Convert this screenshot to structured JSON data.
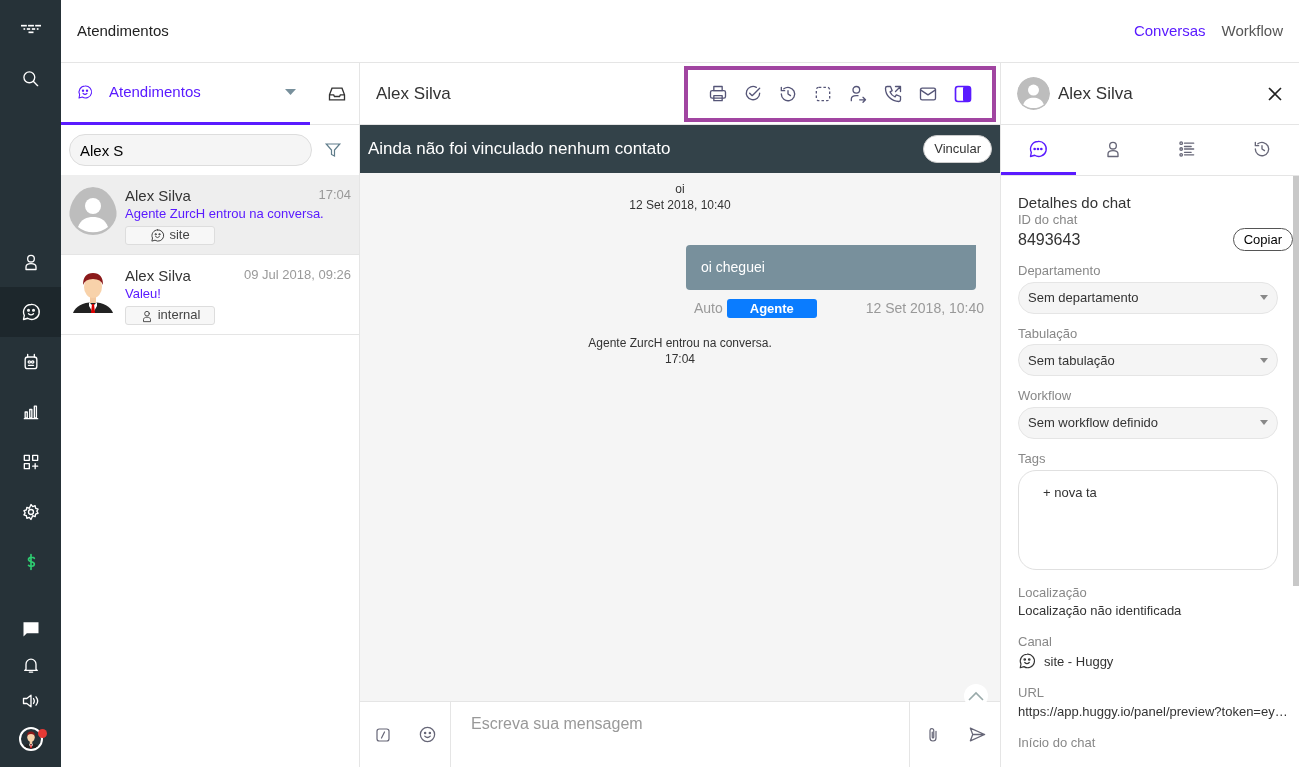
{
  "sidebar": {
    "top_items": [
      {
        "kind": "logo",
        "selected": false
      },
      {
        "kind": "search",
        "selected": false
      }
    ],
    "items": [
      {
        "kind": "contacts",
        "selected": false
      },
      {
        "kind": "chats",
        "selected": true
      },
      {
        "kind": "bot",
        "selected": false
      },
      {
        "kind": "reports",
        "selected": false
      },
      {
        "kind": "apps",
        "selected": false
      },
      {
        "kind": "settings",
        "selected": false
      },
      {
        "kind": "billing",
        "selected": false
      }
    ],
    "bottom_items": [
      {
        "kind": "messages",
        "selected": false
      },
      {
        "kind": "bell",
        "selected": false
      },
      {
        "kind": "sound",
        "selected": false
      },
      {
        "kind": "avatar",
        "selected": false
      }
    ]
  },
  "topbar": {
    "title": "Atendimentos",
    "links": [
      {
        "label": "Conversas",
        "selected": true
      },
      {
        "label": "Workflow",
        "selected": false
      }
    ]
  },
  "list_panel": {
    "tab": {
      "label": "Atendimentos",
      "selected": true
    },
    "search": {
      "value": "Alex S"
    },
    "conversations": [
      {
        "name": "Alex Silva",
        "time": "17:04",
        "preview": "Agente ZurcH entrou na conversa.",
        "channel": {
          "label": "site",
          "kind": "site"
        },
        "avatar": {
          "kind": "placeholder"
        },
        "selected": true
      },
      {
        "name": "Alex Silva",
        "time": "09 Jul 2018, 09:26",
        "preview": "Valeu!",
        "channel": {
          "label": "internal",
          "kind": "internal"
        },
        "avatar": {
          "kind": "figure"
        },
        "selected": false
      }
    ]
  },
  "chat": {
    "title": "Alex Silva",
    "toolbar": [
      {
        "kind": "print",
        "selected": false
      },
      {
        "kind": "check",
        "selected": false
      },
      {
        "kind": "history",
        "selected": false
      },
      {
        "kind": "select",
        "selected": false
      },
      {
        "kind": "transfer",
        "selected": false
      },
      {
        "kind": "call",
        "selected": false
      },
      {
        "kind": "mail",
        "selected": false
      },
      {
        "kind": "panel",
        "selected": true
      }
    ],
    "banner": {
      "text": "Ainda não foi vinculado nenhum contato",
      "button": "Vincular"
    },
    "messages": [
      {
        "kind": "system",
        "text": "oi",
        "time": "12 Set 2018, 10:40"
      },
      {
        "kind": "outgoing",
        "text": "oi cheguei",
        "sender": "Auto",
        "badge": "Agente",
        "time": "12 Set 2018, 10:40"
      },
      {
        "kind": "system",
        "text": "Agente ZurcH entrou na conversa.",
        "time": "17:04"
      }
    ],
    "composer": {
      "placeholder": "Escreva sua mensagem"
    }
  },
  "details": {
    "name": "Alex Silva",
    "tabs": [
      {
        "kind": "chat",
        "selected": true
      },
      {
        "kind": "contact",
        "selected": false
      },
      {
        "kind": "list",
        "selected": false
      },
      {
        "kind": "history",
        "selected": false
      }
    ],
    "title": "Detalhes do chat",
    "id_label": "ID do chat",
    "id_value": "8493643",
    "copy_button": "Copiar",
    "selects": [
      {
        "label": "Departamento",
        "value": "Sem departamento"
      },
      {
        "label": "Tabulação",
        "value": "Sem tabulação"
      },
      {
        "label": "Workflow",
        "value": "Sem workflow definido"
      }
    ],
    "tags": {
      "label": "Tags",
      "placeholder": "+ nova ta"
    },
    "info": [
      {
        "label": "Localização",
        "value": "Localização não identificada",
        "kind": "text"
      },
      {
        "label": "Canal",
        "value": "site - Huggy",
        "kind": "channel"
      },
      {
        "label": "URL",
        "value": "https://app.huggy.io/panel/preview?token=ey…",
        "kind": "text"
      },
      {
        "label": "Início do chat",
        "kind": "text"
      }
    ]
  }
}
